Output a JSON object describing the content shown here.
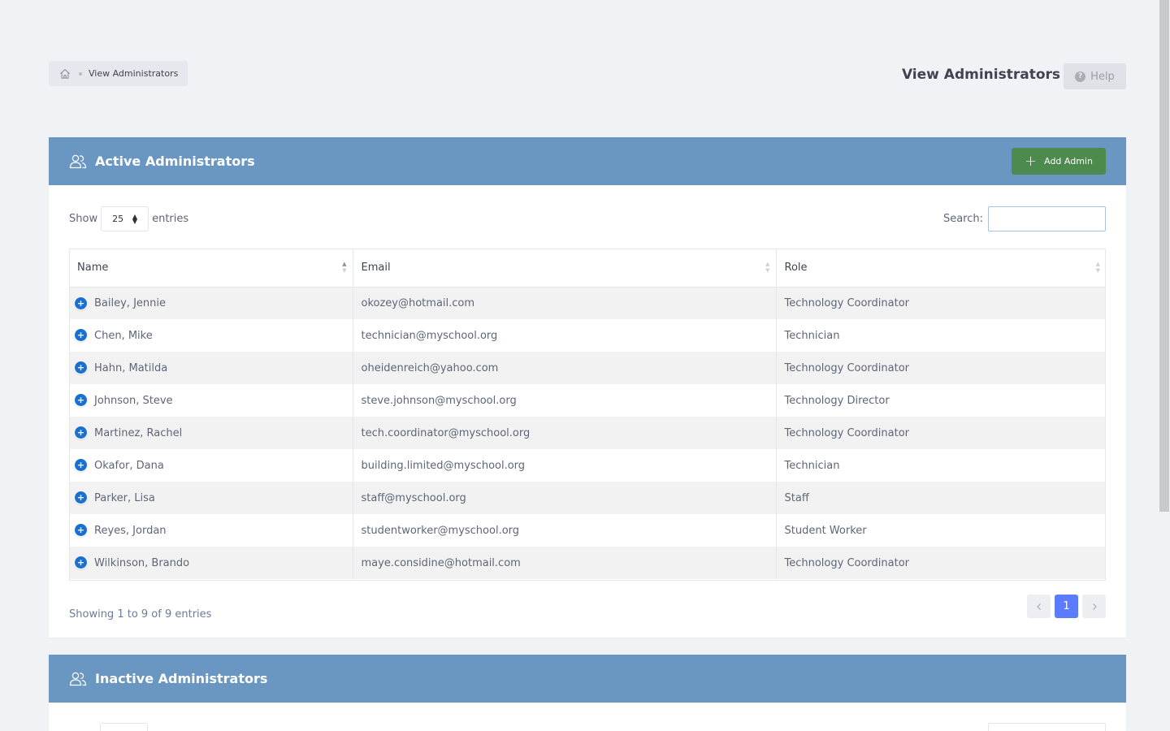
{
  "breadcrumb": {
    "current": "View Administrators"
  },
  "header": {
    "title": "View Administrators",
    "help_label": "Help"
  },
  "active": {
    "title": "Active Administrators",
    "add_label": "Add Admin",
    "show_label": "Show",
    "entries_label": "entries",
    "page_length": "25",
    "search_label": "Search:",
    "search_value": "",
    "columns": [
      "Name",
      "Email",
      "Role"
    ],
    "rows": [
      {
        "name": "Bailey, Jennie",
        "email": "okozey@hotmail.com",
        "role": "Technology Coordinator"
      },
      {
        "name": "Chen, Mike",
        "email": "technician@myschool.org",
        "role": "Technician"
      },
      {
        "name": "Hahn, Matilda",
        "email": "oheidenreich@yahoo.com",
        "role": "Technology Coordinator"
      },
      {
        "name": "Johnson, Steve",
        "email": "steve.johnson@myschool.org",
        "role": "Technology Director"
      },
      {
        "name": "Martinez, Rachel",
        "email": "tech.coordinator@myschool.org",
        "role": "Technology Coordinator"
      },
      {
        "name": "Okafor, Dana",
        "email": "building.limited@myschool.org",
        "role": "Technician"
      },
      {
        "name": "Parker, Lisa",
        "email": "staff@myschool.org",
        "role": "Staff"
      },
      {
        "name": "Reyes, Jordan",
        "email": "studentworker@myschool.org",
        "role": "Student Worker"
      },
      {
        "name": "Wilkinson, Brando",
        "email": "maye.considine@hotmail.com",
        "role": "Technology Coordinator"
      }
    ],
    "info": "Showing 1 to 9 of 9 entries",
    "current_page": "1"
  },
  "inactive": {
    "title": "Inactive Administrators"
  },
  "colors": {
    "header_bg": "#6a97c2",
    "add_button": "#4d8a4e",
    "page_active": "#5b7cff",
    "expand_icon": "#1b6fd0"
  },
  "icons": {
    "home": "home-icon",
    "users": "users-icon",
    "help": "question-circle-icon",
    "plus": "plus-icon",
    "expand": "plus-circle-icon"
  }
}
